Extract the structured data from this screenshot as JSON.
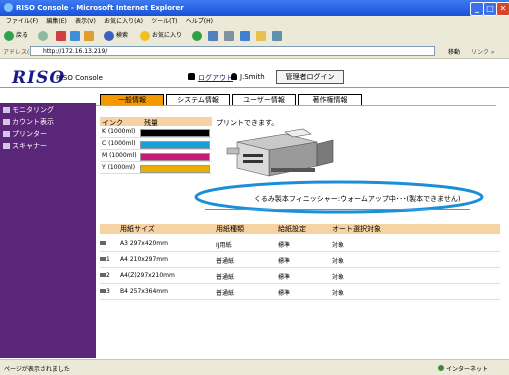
{
  "window": {
    "title": "RISO Console - Microsoft Internet Explorer",
    "min": "_",
    "max": "□",
    "close": "✕"
  },
  "menu": [
    "ファイル(F)",
    "編集(E)",
    "表示(V)",
    "お気に入り(A)",
    "ツール(T)",
    "ヘルプ(H)"
  ],
  "toolbar": {
    "back": "戻る",
    "search": "検索",
    "favorites": "お気に入り"
  },
  "address": {
    "label": "アドレス(D)",
    "url": "http://172.16.13.219/",
    "go": "移動",
    "links": "リンク »"
  },
  "header": {
    "logo": "RISO",
    "product": "RISO Console",
    "logout": "ログアウト",
    "user": "J.Smith",
    "admin_login": "管理者ログイン"
  },
  "sidebar": [
    "モニタリング",
    "カウント表示",
    "プリンター",
    "スキャナー"
  ],
  "tabs": [
    "一般情報",
    "システム情報",
    "ユーザー情報",
    "著作権情報"
  ],
  "ink": {
    "col_ink": "インク",
    "col_remaining": "残量",
    "rows": [
      {
        "label": "K (1000ml)",
        "color": "#000000",
        "level": 1.0
      },
      {
        "label": "C (1000ml)",
        "color": "#1aa0d8",
        "level": 1.0
      },
      {
        "label": "M (1000ml)",
        "color": "#c8197a",
        "level": 1.0
      },
      {
        "label": "Y (1000ml)",
        "color": "#e8b000",
        "level": 1.0
      }
    ]
  },
  "printer_status": "プリントできます。",
  "finisher_status": "くるみ製本フィニッシャー:ウォームアップ中･･･(製本できません)",
  "paper": {
    "headers": [
      "用紙サイズ",
      "用紙種類",
      "給紙設定",
      "オート選択対象"
    ],
    "rows": [
      {
        "tray": "",
        "size": "A3 297x420mm",
        "type": "IJ用紙",
        "feed": "標準",
        "auto": "対象"
      },
      {
        "tray": "1",
        "size": "A4 210x297mm",
        "type": "普通紙",
        "feed": "標準",
        "auto": "対象"
      },
      {
        "tray": "2",
        "size": "A4(Z)297x210mm",
        "type": "普通紙",
        "feed": "標準",
        "auto": "対象"
      },
      {
        "tray": "3",
        "size": "B4 257x364mm",
        "type": "普通紙",
        "feed": "標準",
        "auto": "対象"
      }
    ]
  },
  "statusbar": {
    "left": "ページが表示されました",
    "right": "インターネット"
  },
  "colors": {
    "accent": "#f39800",
    "sidebar": "#5a2677",
    "highlight": "#1a8fd8"
  }
}
